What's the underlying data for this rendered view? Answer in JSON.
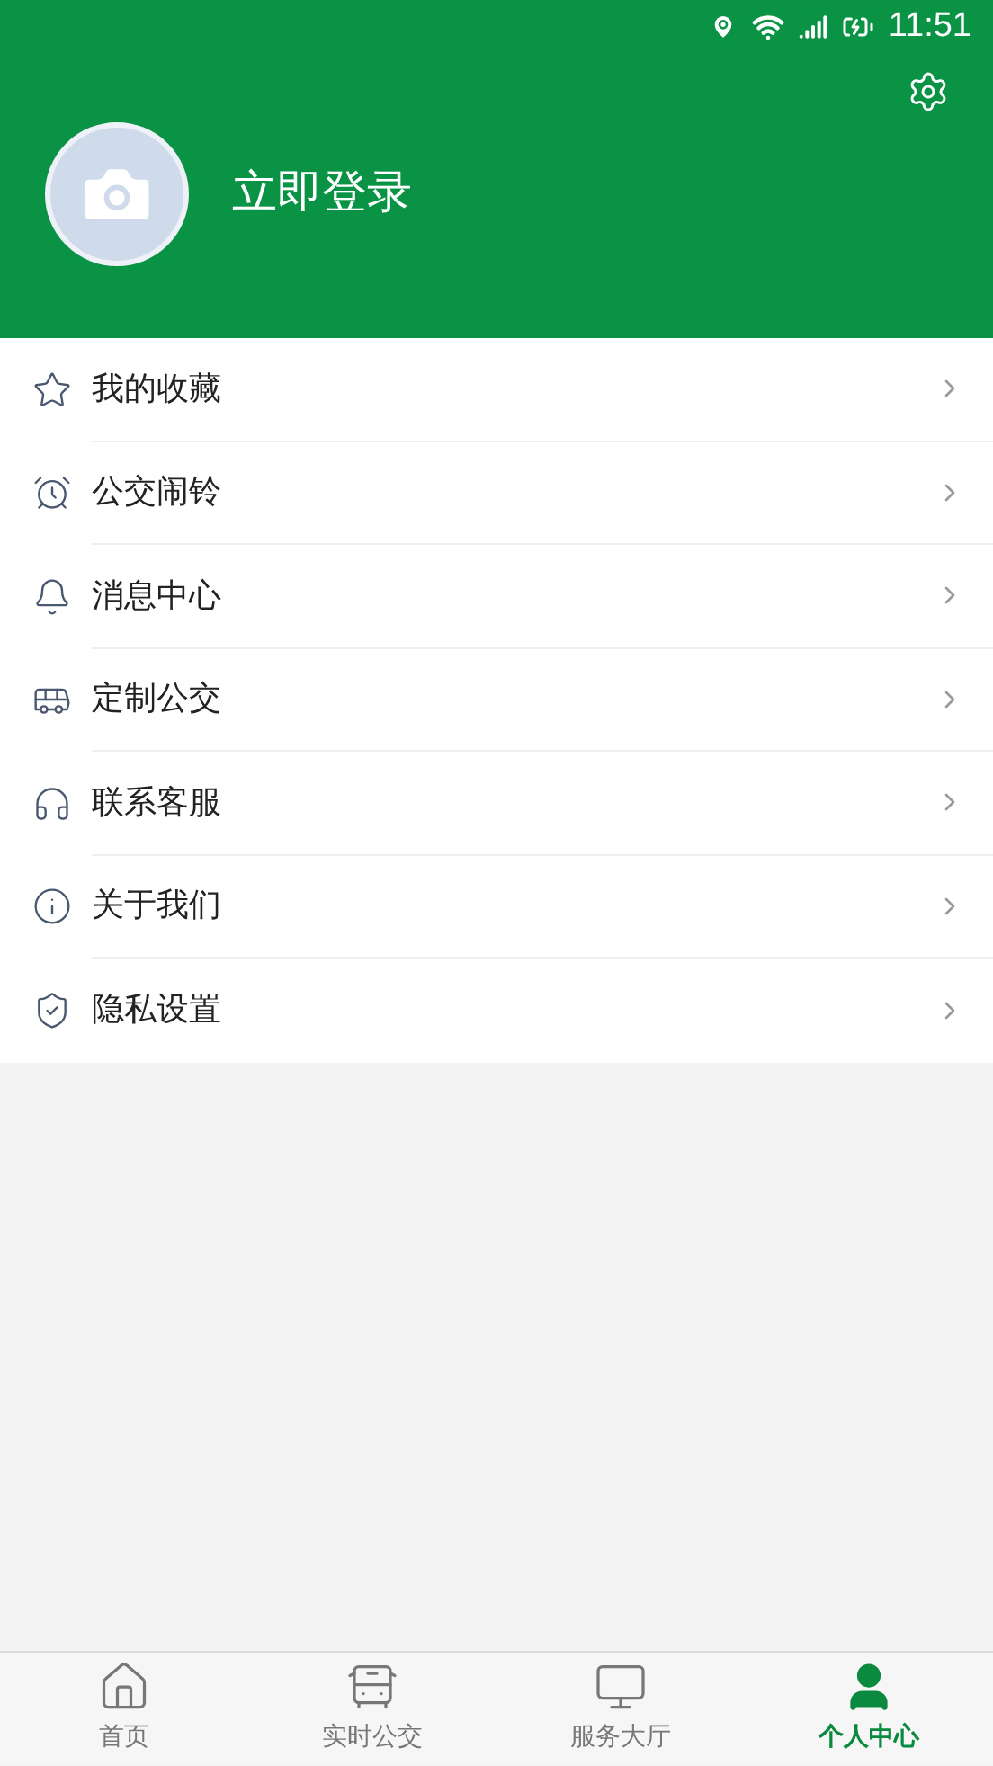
{
  "status_bar": {
    "time": "11:51"
  },
  "header": {
    "login": "立即登录"
  },
  "menu": [
    {
      "label": "我的收藏"
    },
    {
      "label": "公交闹铃"
    },
    {
      "label": "消息中心"
    },
    {
      "label": "定制公交"
    },
    {
      "label": "联系客服"
    },
    {
      "label": "关于我们"
    },
    {
      "label": "隐私设置"
    }
  ],
  "tabs": [
    {
      "label": "首页",
      "selected": false
    },
    {
      "label": "实时公交",
      "selected": false
    },
    {
      "label": "服务大厅",
      "selected": false
    },
    {
      "label": "个人中心",
      "selected": true
    }
  ]
}
